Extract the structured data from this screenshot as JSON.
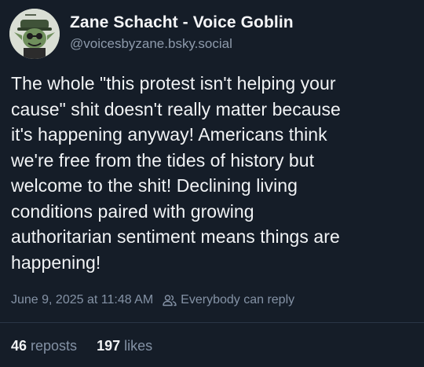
{
  "author": {
    "display_name": "Zane Schacht - Voice Goblin",
    "handle": "@voicesbyzane.bsky.social",
    "avatar_icon": "goblin-avatar-icon"
  },
  "post": {
    "text": "The whole \"this protest isn't helping your\ncause\" shit doesn't really matter because\nit's happening anyway! Americans think\nwe're free from the tides of history but\nwelcome to the shit! Declining living\nconditions paired with growing\nauthoritarian sentiment means things are\nhappening!",
    "timestamp": "June 9, 2025 at 11:48 AM",
    "reply_setting": "Everybody can reply",
    "reply_icon": "people-icon"
  },
  "stats": {
    "reposts_count": "46",
    "reposts_label": "reposts",
    "likes_count": "197",
    "likes_label": "likes"
  },
  "colors": {
    "background": "#151d28",
    "text_primary": "#f1f3f5",
    "text_secondary": "#8492a5",
    "divider": "#2a3646"
  }
}
